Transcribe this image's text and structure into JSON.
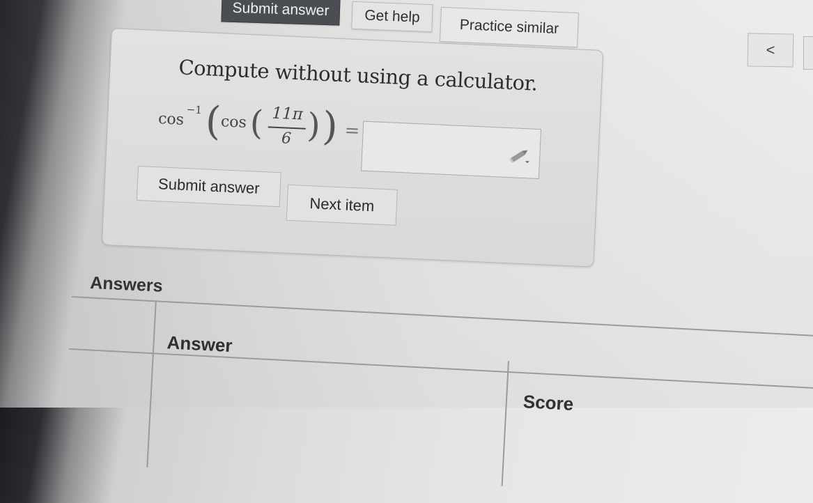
{
  "toolbar": {
    "submit_label": "Submit answer",
    "help_label": "Get help",
    "practice_label": "Practice similar"
  },
  "nav": {
    "prev_label": "<"
  },
  "question": {
    "prompt": "Compute without using a calculator.",
    "func_outer": "cos",
    "exponent": "−1",
    "func_inner": "cos",
    "numerator": "11π",
    "denominator": "6",
    "equals": "=",
    "answer_value": ""
  },
  "actions": {
    "submit_label": "Submit answer",
    "next_label": "Next item"
  },
  "answers": {
    "title": "Answers",
    "columns": [
      "",
      "Answer",
      "Score"
    ]
  },
  "icons": {
    "pencil": "pencil-icon",
    "prev": "chevron-left-icon"
  }
}
